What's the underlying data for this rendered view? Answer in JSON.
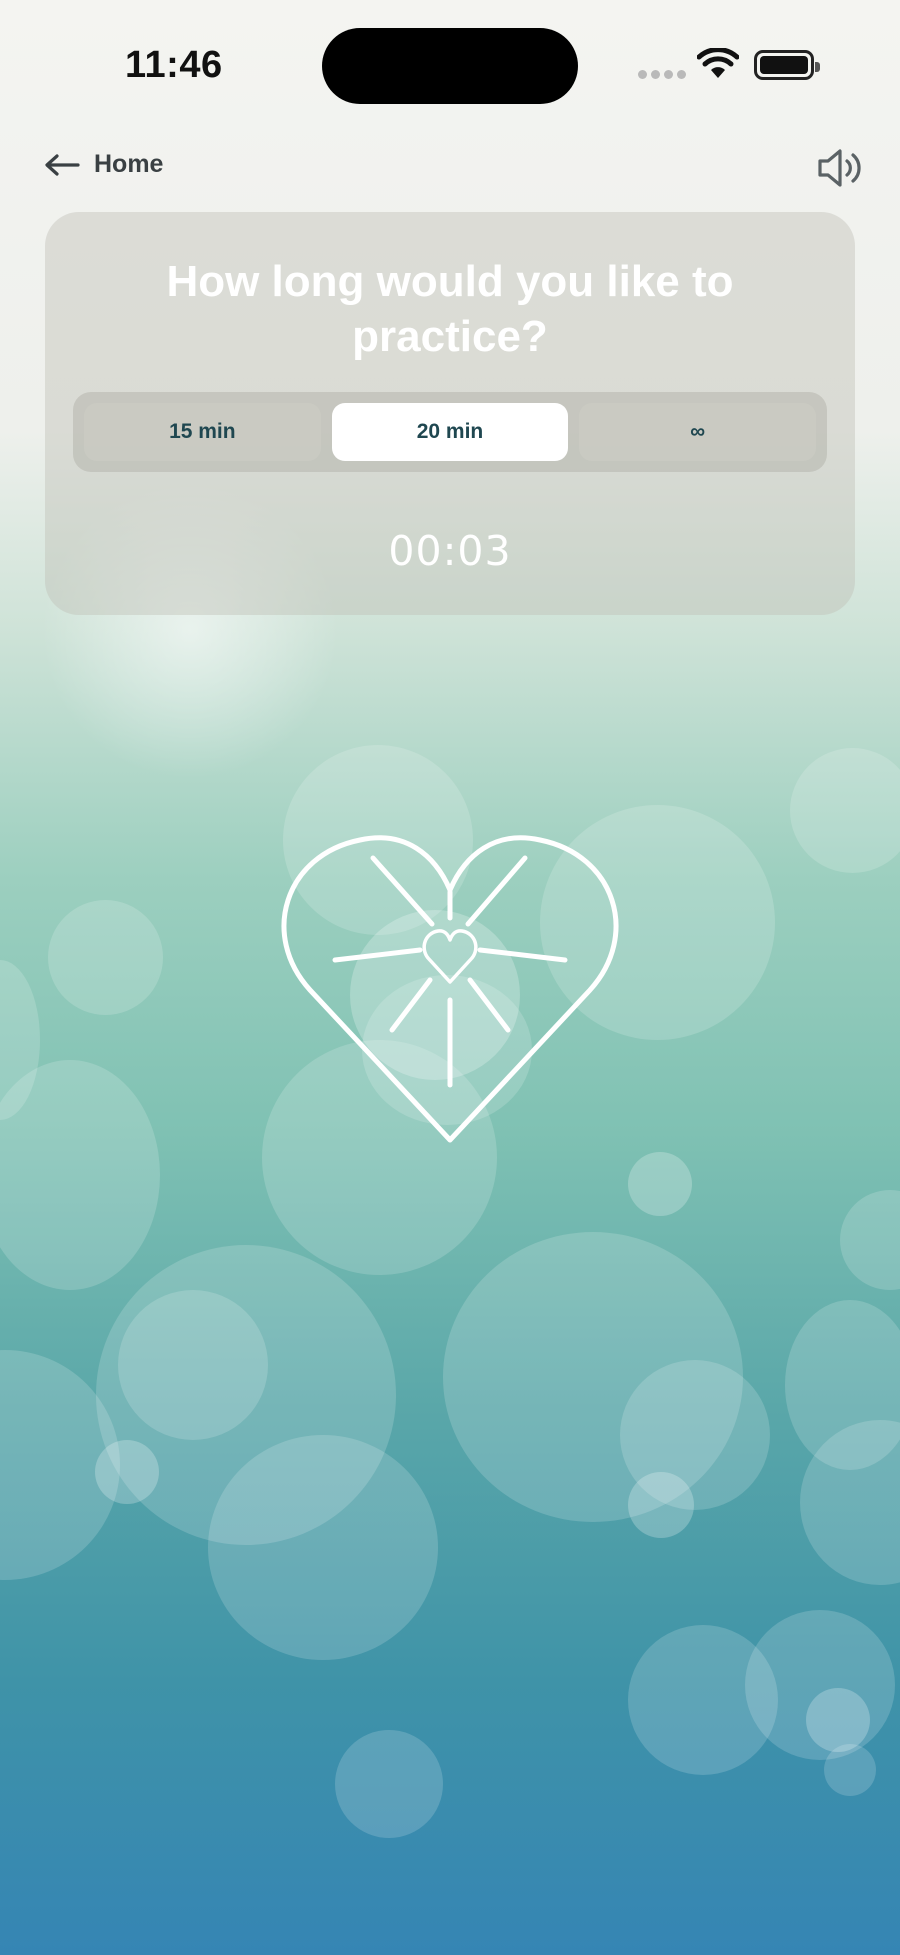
{
  "status_bar": {
    "time": "11:46",
    "wifi_icon": "wifi-icon",
    "battery_icon": "battery-icon",
    "signal_icon": "cellular-signal-icon"
  },
  "nav": {
    "back_label": "Home",
    "back_icon": "arrow-left-icon",
    "sound_icon": "speaker-volume-icon"
  },
  "practice": {
    "title": "How long would you like to practice?",
    "options": [
      "15 min",
      "20 min",
      "∞"
    ],
    "selected": "20 min",
    "timer": "00:03"
  },
  "illustration": {
    "icon": "heart-radiating-icon"
  },
  "colors": {
    "title_text": "#ffffff",
    "segment_text": "#1f4750",
    "selected_segment": "#ffffff",
    "background_top": "#f4f4f1",
    "background_bottom": "#3585b4"
  }
}
